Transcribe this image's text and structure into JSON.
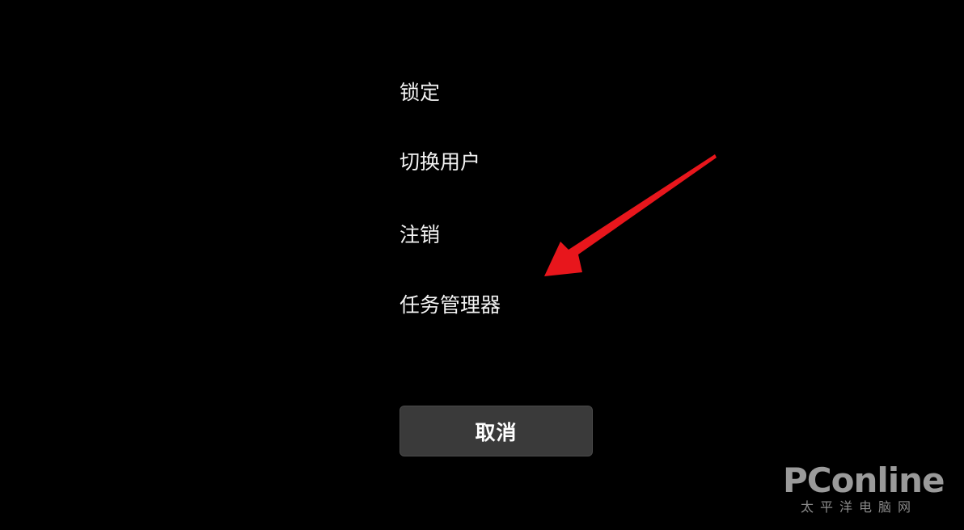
{
  "menu": {
    "items": [
      {
        "label": "锁定"
      },
      {
        "label": "切换用户"
      },
      {
        "label": "注销"
      },
      {
        "label": "任务管理器"
      }
    ]
  },
  "cancel": {
    "label": "取消"
  },
  "watermark": {
    "brand": "PConline",
    "subtitle": "太平洋电脑网"
  },
  "colors": {
    "background": "#000000",
    "text": "#f2f2f2",
    "button_bg": "#3a3a3a",
    "arrow": "#e8161c",
    "watermark": "#9a9a9a"
  },
  "annotation": {
    "icon": "red-arrow-icon"
  }
}
